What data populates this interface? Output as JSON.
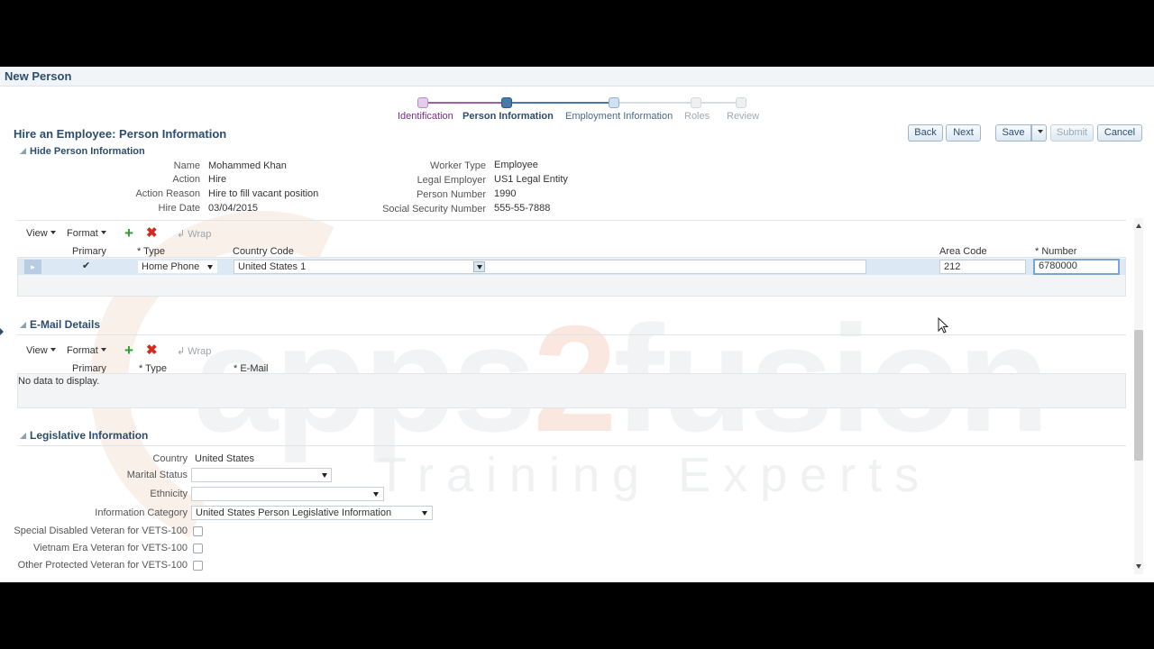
{
  "app": {
    "title": "New Person"
  },
  "train": {
    "stops": [
      {
        "label": "Identification",
        "state": "visited",
        "color": "#7a2d86"
      },
      {
        "label": "Person Information",
        "state": "current",
        "color": "#2d4d6f"
      },
      {
        "label": "Employment Information",
        "state": "next",
        "color": "#4a6a8a"
      },
      {
        "label": "Roles",
        "state": "unvisited",
        "color": "#a0a8b0"
      },
      {
        "label": "Review",
        "state": "unvisited",
        "color": "#a0a8b0"
      }
    ]
  },
  "page": {
    "title": "Hire an Employee: Person Information"
  },
  "buttons": {
    "back": "Back",
    "next": "Next",
    "save": "Save",
    "submit": "Submit",
    "cancel": "Cancel"
  },
  "person_info": {
    "header": "Hide Person Information",
    "left": [
      {
        "label": "Name",
        "value": "Mohammed Khan"
      },
      {
        "label": "Action",
        "value": "Hire"
      },
      {
        "label": "Action Reason",
        "value": "Hire to fill vacant position"
      },
      {
        "label": "Hire Date",
        "value": "03/04/2015"
      }
    ],
    "right": [
      {
        "label": "Worker Type",
        "value": "Employee"
      },
      {
        "label": "Legal Employer",
        "value": "US1 Legal Entity"
      },
      {
        "label": "Person Number",
        "value": "1990"
      },
      {
        "label": "Social Security Number",
        "value": "555-55-7888"
      }
    ]
  },
  "toolbar": {
    "view": "View",
    "format": "Format",
    "wrap": "Wrap"
  },
  "phone_table": {
    "headers": {
      "primary": "Primary",
      "type": "* Type",
      "country_code": "Country Code",
      "area_code": "Area Code",
      "number": "* Number"
    },
    "row": {
      "primary": true,
      "type": "Home Phone",
      "country_code": "United States 1",
      "area_code": "212",
      "number": "6780000"
    }
  },
  "email": {
    "header": "E-Mail Details",
    "headers": {
      "primary": "Primary",
      "type": "* Type",
      "email": "* E-Mail"
    },
    "empty": "No data to display."
  },
  "legislative": {
    "header": "Legislative Information",
    "country_label": "Country",
    "country_value": "United States",
    "marital_label": "Marital Status",
    "marital_value": "",
    "ethnicity_label": "Ethnicity",
    "ethnicity_value": "",
    "info_cat_label": "Information Category",
    "info_cat_value": "United States Person Legislative Information",
    "checkboxes": [
      {
        "label": "Special Disabled Veteran for VETS-100",
        "checked": false
      },
      {
        "label": "Vietnam Era Veteran for VETS-100",
        "checked": false
      },
      {
        "label": "Other Protected Veteran for VETS-100",
        "checked": false
      }
    ]
  },
  "watermark": {
    "main_a": "apps",
    "main_b": "2",
    "main_c": "fusion",
    "sub": "Training Experts"
  },
  "icons": {
    "add": "plus-icon",
    "delete": "x-icon",
    "wrap": "wrap-icon",
    "expand": "triangle-icon"
  }
}
